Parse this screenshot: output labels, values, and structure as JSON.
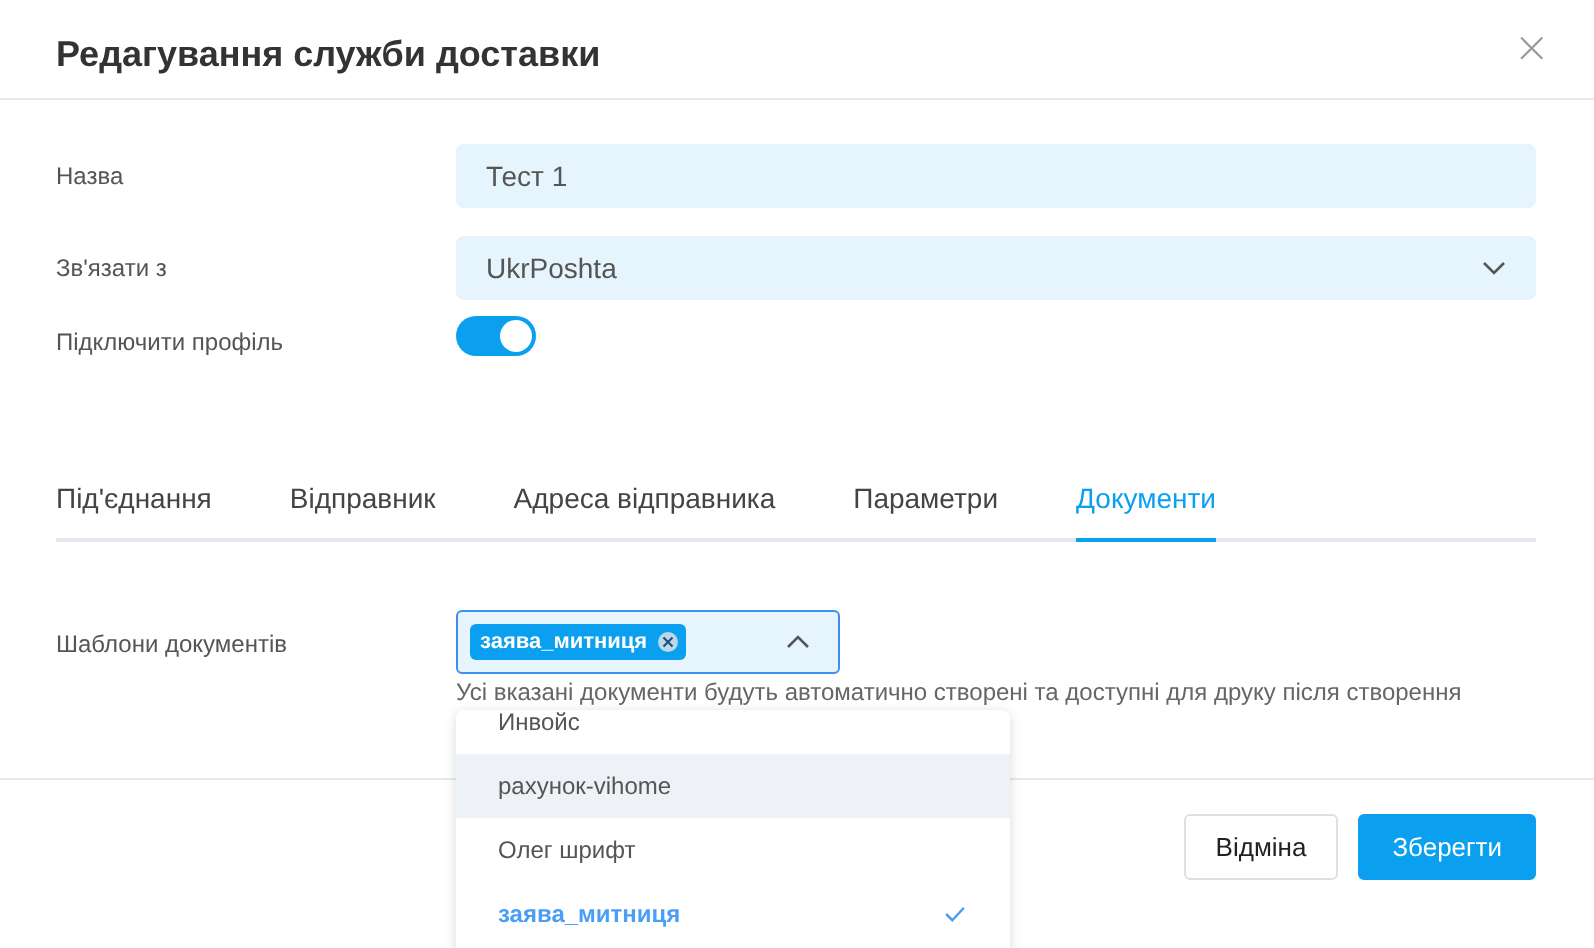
{
  "window": {
    "title": "Редагування служби доставки",
    "close": "×"
  },
  "fields": [
    {
      "kind": "input",
      "label": "Назва",
      "value": "Тест 1"
    },
    {
      "kind": "select",
      "label": "Зв'язати з",
      "value": "UkrPoshta"
    },
    {
      "kind": "toggle",
      "label": "Підключити профіль",
      "on": true
    }
  ],
  "tabs": [
    {
      "label": "Під'єднання",
      "selected": false
    },
    {
      "label": "Відправник",
      "selected": false
    },
    {
      "label": "Адреса відправника",
      "selected": false
    },
    {
      "label": "Параметри",
      "selected": false
    },
    {
      "label": "Документи",
      "selected": true
    }
  ],
  "documents": {
    "label": "Шаблони документів",
    "tags": [
      "заява_митниця"
    ],
    "hint": "Усі вказані документи будуть автоматично створені та доступні для друку після створення",
    "options": [
      {
        "label": "Инвойс",
        "selected": false,
        "hovered": false
      },
      {
        "label": "рахунок-vihome",
        "selected": false,
        "hovered": true
      },
      {
        "label": "Олег шрифт",
        "selected": false,
        "hovered": false
      },
      {
        "label": "заява_митниця",
        "selected": true,
        "hovered": false
      }
    ]
  },
  "buttons": [
    {
      "kind": "secondary",
      "label": "Відміна"
    },
    {
      "kind": "primary",
      "label": "Зберегти"
    }
  ]
}
